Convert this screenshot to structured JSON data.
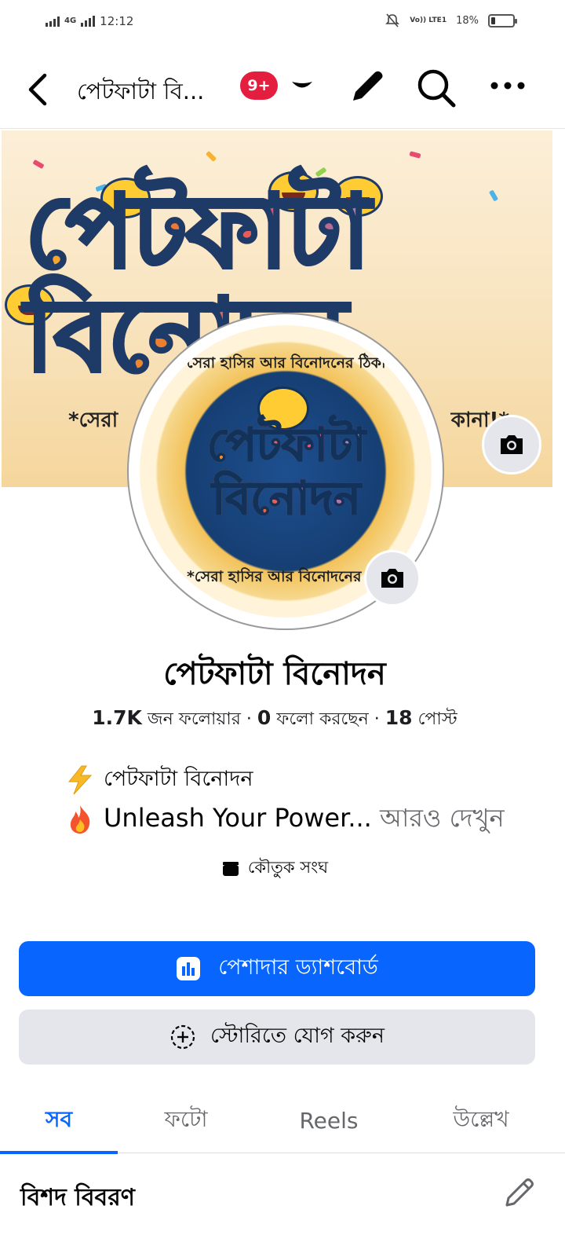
{
  "status_bar": {
    "network": "4G",
    "time": "12:12",
    "volte": "Vo)) LTE1",
    "battery": "18%",
    "battery_level": 0.18
  },
  "top_bar": {
    "page_name": "পেটফাটা বি...",
    "notification_badge": "9+",
    "icons": [
      "back-arrow-icon",
      "caret-down-icon",
      "pencil-icon",
      "search-icon",
      "more-icon"
    ]
  },
  "cover": {
    "title_art": "পেটফাটা বিনোদন",
    "tag_left": "*সেরা",
    "tag_right": "কানা!*"
  },
  "avatar": {
    "word_line1": "পেটফাটা",
    "word_line2": "বিনোদন",
    "ring_text_top": "*সেরা হাসির আর বিনোদনের ঠিকানা!*",
    "ring_text_bottom": "*সেরা হাসির আর বিনোদনের ঠিকানা!*"
  },
  "profile": {
    "name": "পেটফাটা বিনোদন",
    "followers_count": "1.7K",
    "followers_label": " জন ফলোয়ার · ",
    "following_count": "0",
    "following_label": " ফলো করছেন · ",
    "posts_count": "18",
    "posts_label": " পোস্ট",
    "bio_line1": "পেটফাটা বিনোদন",
    "bio_line2": "Unleash Your Power...",
    "see_more": " আরও দেখুন",
    "category": "কৌতুক সংঘ"
  },
  "actions": {
    "dashboard_label": "পেশাদার ড্যাশবোর্ড",
    "story_label": "স্টোরিতে যোগ করুন"
  },
  "tabs": [
    {
      "label": "সব",
      "active": true
    },
    {
      "label": "ফটো",
      "active": false
    },
    {
      "label": "Reels",
      "active": false
    },
    {
      "label": "উল্লেখ",
      "active": false
    }
  ],
  "details": {
    "title": "বিশদ বিবরণ"
  },
  "colors": {
    "accent": "#0866ff",
    "badge": "#e41e3f",
    "secondary_button": "#e4e6eb"
  }
}
